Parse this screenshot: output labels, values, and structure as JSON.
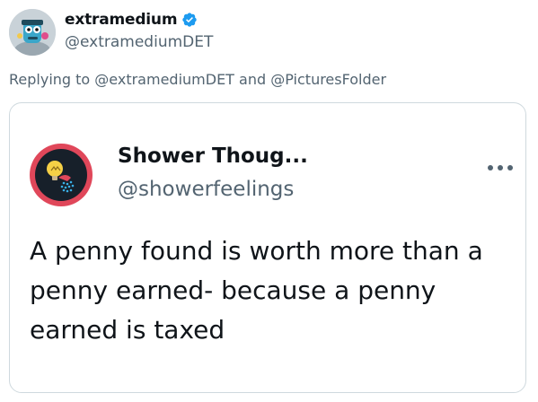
{
  "tweet": {
    "author": {
      "display_name": "extramedium",
      "handle": "@extramediumDET",
      "verified": true,
      "avatar_icon": "cartoon-character-avatar"
    },
    "reply_context": {
      "prefix": "Replying to",
      "mention_1": "@extramediumDET",
      "conjunction": "and",
      "mention_2": "@PicturesFolder"
    },
    "quoted": {
      "display_name": "Shower Thoug...",
      "handle": "@showerfeelings",
      "avatar_icon": "lightbulb-shower-icon",
      "more_icon": "more-horizontal-icon",
      "text": "A penny found is worth more than a penny earned- because a penny earned is taxed"
    }
  },
  "colors": {
    "verified": "#1d9bf0",
    "secondary_text": "#536471",
    "card_avatar_ring": "#e0475a",
    "card_border": "#cfd9de"
  }
}
